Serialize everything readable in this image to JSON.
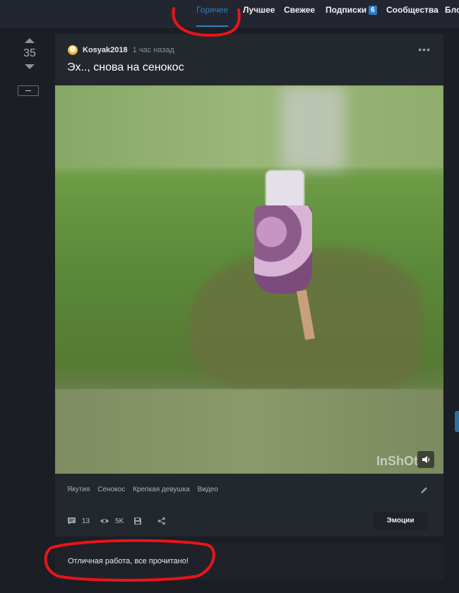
{
  "nav": {
    "items": [
      {
        "label": "Горячее",
        "active": true
      },
      {
        "label": "Лучшее"
      },
      {
        "label": "Свежее"
      },
      {
        "label": "Подписки",
        "badge": "6"
      },
      {
        "label": "Сообщества"
      },
      {
        "label": "Бло"
      }
    ]
  },
  "vote": {
    "count": "35"
  },
  "post": {
    "author": "Kosyak2018",
    "time": "1 час назад",
    "title": "Эх.., снова на сенокос",
    "media": {
      "watermark": "InShOt"
    },
    "tags": [
      "Якутия",
      "Сенокос",
      "Крепкая девушка",
      "Видео"
    ],
    "comments_count": "13",
    "views": "5K",
    "emotions_label": "Эмоции"
  },
  "comment": {
    "text": "Отличная работа, все прочитано!"
  },
  "colors": {
    "accent": "#2f7fb8",
    "marker": "#e8141a",
    "background": "#1b1e24",
    "card": "#23272e"
  }
}
